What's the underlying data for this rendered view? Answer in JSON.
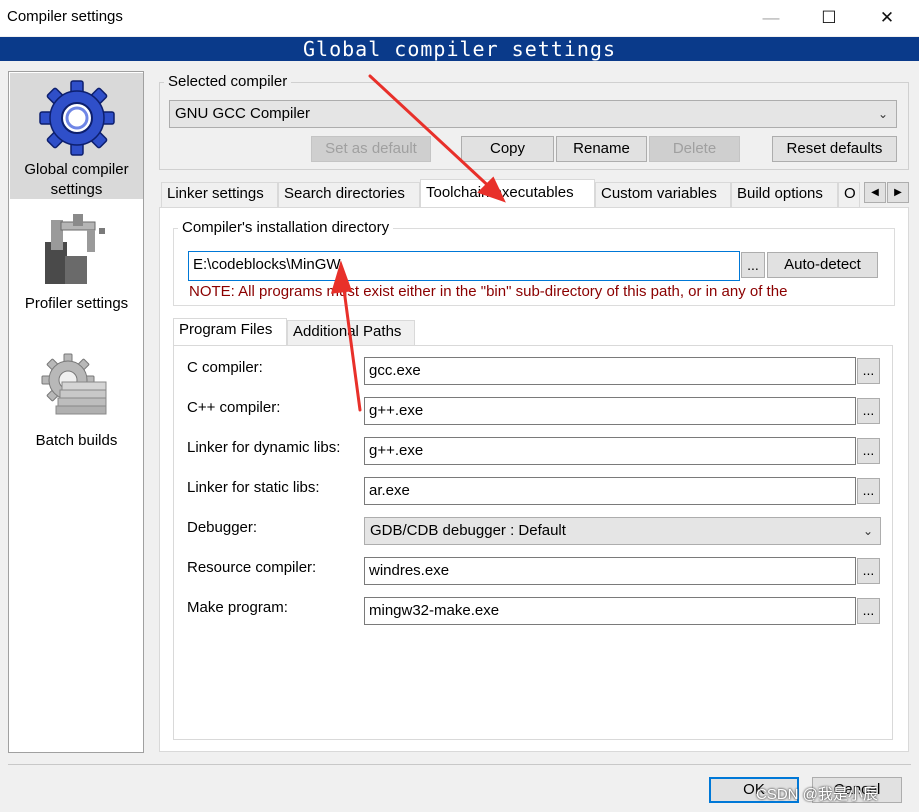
{
  "window": {
    "title": "Compiler settings",
    "minimize_glyph": "—",
    "maximize_glyph": "☐",
    "close_glyph": "✕"
  },
  "banner": "Global compiler settings",
  "nav": [
    {
      "label": "Global compiler settings",
      "icon": "gear-icon",
      "selected": true
    },
    {
      "label": "Profiler settings",
      "icon": "caliper-icon",
      "selected": false
    },
    {
      "label": "Batch builds",
      "icon": "batch-gear-icon",
      "selected": false
    }
  ],
  "selected_compiler": {
    "group_title": "Selected compiler",
    "value": "GNU GCC Compiler",
    "buttons": {
      "set_default": "Set as default",
      "copy": "Copy",
      "rename": "Rename",
      "delete": "Delete",
      "reset": "Reset defaults"
    }
  },
  "main_tabs": [
    "Linker settings",
    "Search directories",
    "Toolchain executables",
    "Custom variables",
    "Build options",
    "O"
  ],
  "active_main_tab": "Toolchain executables",
  "install_dir": {
    "group_title": "Compiler's installation directory",
    "value": "E:\\codeblocks\\MinGW",
    "browse": "...",
    "autodetect": "Auto-detect",
    "note": "NOTE: All programs must exist either in the \"bin\" sub-directory of this path, or in any of the"
  },
  "sub_tabs": [
    "Program Files",
    "Additional Paths"
  ],
  "programs": [
    {
      "label": "C compiler:",
      "value": "gcc.exe"
    },
    {
      "label": "C++ compiler:",
      "value": "g++.exe"
    },
    {
      "label": "Linker for dynamic libs:",
      "value": "g++.exe"
    },
    {
      "label": "Linker for static libs:",
      "value": "ar.exe"
    },
    {
      "label": "Debugger:",
      "value": "GDB/CDB debugger : Default"
    },
    {
      "label": "Resource compiler:",
      "value": "windres.exe"
    },
    {
      "label": "Make program:",
      "value": "mingw32-make.exe"
    }
  ],
  "footer": {
    "ok": "OK",
    "cancel": "Cancel",
    "watermark": "CSDN @我是小辰"
  },
  "colors": {
    "banner_bg": "#0a3a8a",
    "note_text": "#8b0000",
    "annotation_arrow": "#e8302a",
    "ok_border": "#0078d7"
  }
}
